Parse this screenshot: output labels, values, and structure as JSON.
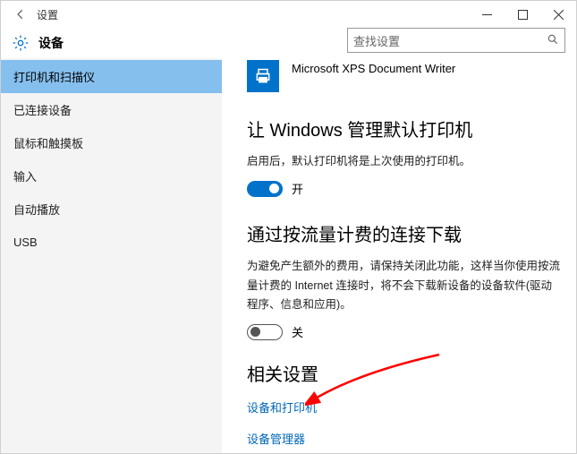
{
  "window": {
    "title": "设置"
  },
  "header": {
    "category": "设备",
    "search_placeholder": "查找设置"
  },
  "sidebar": {
    "items": [
      {
        "label": "打印机和扫描仪"
      },
      {
        "label": "已连接设备"
      },
      {
        "label": "鼠标和触摸板"
      },
      {
        "label": "输入"
      },
      {
        "label": "自动播放"
      },
      {
        "label": "USB"
      }
    ],
    "selected_index": 0
  },
  "main": {
    "printer": {
      "name": "Microsoft XPS Document Writer"
    },
    "section1": {
      "title": "让 Windows 管理默认打印机",
      "desc": "启用后，默认打印机将是上次使用的打印机。",
      "toggle_on": true,
      "toggle_label": "开"
    },
    "section2": {
      "title": "通过按流量计费的连接下载",
      "desc": "为避免产生额外的费用，请保持关闭此功能，这样当你使用按流量计费的 Internet 连接时，将不会下载新设备的设备软件(驱动程序、信息和应用)。",
      "toggle_on": false,
      "toggle_label": "关"
    },
    "related": {
      "title": "相关设置",
      "links": [
        "设备和打印机",
        "设备管理器"
      ]
    }
  }
}
